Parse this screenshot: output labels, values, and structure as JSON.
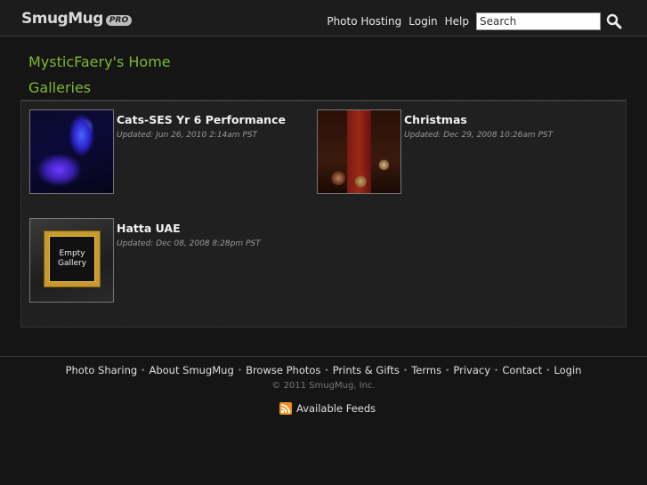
{
  "header": {
    "logo_text": "SmugMug",
    "logo_badge": "PRO",
    "nav": [
      "Photo Hosting",
      "Login",
      "Help"
    ],
    "search_placeholder": "Search",
    "search_icon": "magnifier"
  },
  "page": {
    "owner_title": "MysticFaery's Home",
    "section_title": "Galleries"
  },
  "galleries": [
    {
      "title": "Cats-SES Yr 6 Performance",
      "updated": "Updated: Jun 26, 2010 2:14am PST"
    },
    {
      "title": "Christmas",
      "updated": "Updated: Dec 29, 2008 10:26am PST"
    },
    {
      "title": "Hatta UAE",
      "updated": "Updated: Dec 08, 2008 8:28pm PST",
      "thumb_text": "Empty Gallery"
    }
  ],
  "footer": {
    "links": [
      "Photo Sharing",
      "About SmugMug",
      "Browse Photos",
      "Prints & Gifts",
      "Terms",
      "Privacy",
      "Contact",
      "Login"
    ],
    "separator": "•",
    "copyright": "© 2011 SmugMug, Inc.",
    "feeds_label": "Available Feeds"
  },
  "colors": {
    "accent_green": "#7fb832",
    "background": "#151515",
    "rss_orange": "#f29022"
  }
}
